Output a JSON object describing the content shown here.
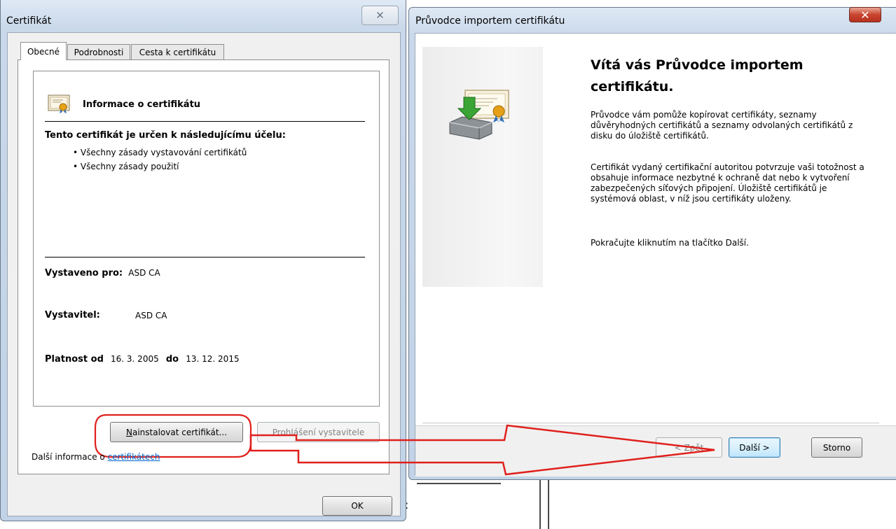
{
  "cert_dialog": {
    "title": "Certifikát",
    "tabs": [
      {
        "label": "Obecné"
      },
      {
        "label": "Podrobnosti"
      },
      {
        "label": "Cesta k certifikátu"
      }
    ],
    "info_heading": "Informace o certifikátu",
    "purpose_heading": "Tento certifikát je určen k následujícímu účelu:",
    "purposes": [
      "Všechny zásady vystavování certifikátů",
      "Všechny zásady použití"
    ],
    "issued_to_label": "Vystaveno pro:",
    "issued_to_value": "ASD CA",
    "issuer_label": "Vystavitel:",
    "issuer_value": "ASD CA",
    "valid_from_label": "Platnost od",
    "valid_from_value": "16. 3. 2005",
    "valid_to_label": "do",
    "valid_to_value": "13. 12. 2015",
    "install_button": "Nainstalovat certifikát...",
    "install_mnemonic": "N",
    "install_rest": "ainstalovat certifikát...",
    "issuer_statement_button": "Prohlášení vystavitele",
    "more_info_prefix": "Další informace o ",
    "more_info_link": "certifikátech",
    "ok_button": "OK"
  },
  "wizard": {
    "title": "Průvodce importem certifikátu",
    "heading": "Vítá vás Průvodce importem certifikátu.",
    "paragraph1": "Průvodce vám pomůže kopírovat certifikáty, seznamy důvěryhodných certifikátů a seznamy odvolaných certifikátů z disku do úložiště certifikátů.",
    "paragraph2": "Certifikát vydaný certifikační autoritou potvrzuje vaši totožnost a obsahuje informace nezbytné k ochraně dat nebo k vytvoření zabezpečených síťových připojení. Úložiště certifikátů je systémová oblast, v níž jsou certifikáty uloženy.",
    "paragraph3": "Pokračujte kliknutím na tlačítko Další.",
    "back_button": "< Zpět",
    "next_button": "Další >",
    "cancel_button": "Storno"
  },
  "annotations": {
    "highlight_color": "#e0201c",
    "arrow_color": "#e0201c"
  },
  "colors": {
    "link": "#0066cc",
    "close_active": "#c9452f"
  }
}
